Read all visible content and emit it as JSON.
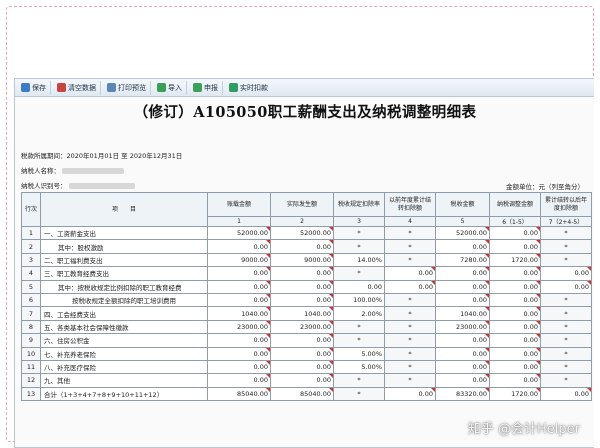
{
  "toolbar": [
    {
      "label": "保存",
      "icon": "save-icon",
      "color": "#3d7bc8"
    },
    {
      "label": "清空数据",
      "icon": "clear-icon",
      "color": "#c8453d"
    },
    {
      "label": "打印预览",
      "icon": "print-icon",
      "color": "#5a86b8"
    },
    {
      "label": "导入",
      "icon": "import-icon",
      "color": "#3aa057"
    },
    {
      "label": "申报",
      "icon": "submit-icon",
      "color": "#3aa057"
    },
    {
      "label": "实时扣款",
      "icon": "payment-icon",
      "color": "#2e9c63"
    }
  ],
  "title": "（修订）A105050职工薪酬支出及纳税调整明细表",
  "meta": {
    "period": "税款所属期间：2020年01月01日 至 2020年12月31日",
    "taxpayer_name": "纳税人名称：",
    "taxpayer_id": "纳税人识别号：",
    "unit": "金额单位：元（列至角分）"
  },
  "table": {
    "headers": [
      "行次",
      "项　　目",
      "账载金额",
      "实际发生额",
      "税收规定扣除率",
      "以前年度累计结转扣除额",
      "税收金额",
      "纳税调整金额",
      "累计结转以后年度扣除额"
    ],
    "col_numbers": [
      "",
      "",
      "1",
      "2",
      "3",
      "4",
      "5",
      "6（1-5）",
      "7（2+4-5）"
    ],
    "rows": [
      {
        "no": "1",
        "item": "一、工资薪金支出",
        "cells": [
          "52000.00",
          "52000.00",
          "*",
          "*",
          "52000.00",
          "0.00",
          "*"
        ],
        "indent": 0
      },
      {
        "no": "2",
        "item": "其中：股权激励",
        "cells": [
          "0.00",
          "0.00",
          "*",
          "*",
          "0.00",
          "0.00",
          "*"
        ],
        "indent": 1
      },
      {
        "no": "3",
        "item": "二、职工福利费支出",
        "cells": [
          "9000.00",
          "9000.00",
          "14.00%",
          "*",
          "7280.00",
          "1720.00",
          "*"
        ],
        "indent": 0
      },
      {
        "no": "4",
        "item": "三、职工教育经费支出",
        "cells": [
          "0.00",
          "0.00",
          "*",
          "0.00",
          "0.00",
          "0.00",
          "0.00"
        ],
        "indent": 0
      },
      {
        "no": "5",
        "item": "其中：按税收规定比例扣除的职工教育经费",
        "cells": [
          "0.00",
          "0.00",
          "0.00",
          "0.00",
          "0.00",
          "0.00",
          "0.00"
        ],
        "indent": 1
      },
      {
        "no": "6",
        "item": "按税收规定全额扣除的职工培训费用",
        "cells": [
          "0.00",
          "0.00",
          "100.00%",
          "*",
          "0.00",
          "0.00",
          "*"
        ],
        "indent": 2
      },
      {
        "no": "7",
        "item": "四、工会经费支出",
        "cells": [
          "1040.00",
          "1040.00",
          "2.00%",
          "*",
          "1040.00",
          "0.00",
          "*"
        ],
        "indent": 0
      },
      {
        "no": "8",
        "item": "五、各类基本社会保障性缴款",
        "cells": [
          "23000.00",
          "23000.00",
          "*",
          "*",
          "23000.00",
          "0.00",
          "*"
        ],
        "indent": 0
      },
      {
        "no": "9",
        "item": "六、住房公积金",
        "cells": [
          "0.00",
          "0.00",
          "*",
          "*",
          "0.00",
          "0.00",
          "*"
        ],
        "indent": 0
      },
      {
        "no": "10",
        "item": "七、补充养老保险",
        "cells": [
          "0.00",
          "0.00",
          "5.00%",
          "*",
          "0.00",
          "0.00",
          "*"
        ],
        "indent": 0
      },
      {
        "no": "11",
        "item": "八、补充医疗保险",
        "cells": [
          "0.00",
          "0.00",
          "5.00%",
          "*",
          "0.00",
          "0.00",
          "*"
        ],
        "indent": 0
      },
      {
        "no": "12",
        "item": "九、其他",
        "cells": [
          "0.00",
          "0.00",
          "*",
          "*",
          "0.00",
          "0.00",
          "*"
        ],
        "indent": 0
      },
      {
        "no": "13",
        "item": "合计（1+3+4+7+8+9+10+11+12）",
        "cells": [
          "85040.00",
          "85040.00",
          "*",
          "0.00",
          "83320.00",
          "1720.00",
          "0.00"
        ],
        "indent": 0
      }
    ]
  },
  "watermark": "知乎 @会计Helper"
}
